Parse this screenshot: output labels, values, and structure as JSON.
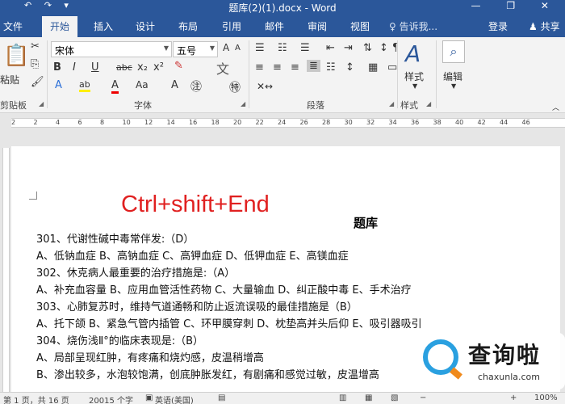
{
  "window": {
    "title": "题库(2)(1).docx - Word",
    "qat": "↶ ↷ ▾",
    "controls": "— ❐ ✕"
  },
  "tabs": [
    {
      "label": "文件"
    },
    {
      "label": "开始"
    },
    {
      "label": "插入"
    },
    {
      "label": "设计"
    },
    {
      "label": "布局"
    },
    {
      "label": "引用"
    },
    {
      "label": "邮件"
    },
    {
      "label": "审阅"
    },
    {
      "label": "视图"
    }
  ],
  "tell_me": "♀ 告诉我...",
  "login": "登录",
  "share": "♟ 共享",
  "ribbon": {
    "paste_label": "粘贴",
    "font_name": "宋体",
    "font_size": "五号",
    "groups": {
      "clipboard": "剪贴板",
      "font": "字体",
      "paragraph": "段落",
      "styles": "样式",
      "styles_btn": "样式",
      "editing": "编辑"
    },
    "font_row1": [
      "B",
      "I",
      "U",
      "abc",
      "x₂",
      "x²"
    ],
    "font_row2": [
      "A",
      "ab",
      "A",
      "Aa",
      "A",
      "㊟"
    ],
    "font_sizes_btns": [
      "A",
      "A",
      "Aa",
      "✎",
      "wen"
    ],
    "para_row1": [
      "☰",
      "☷",
      "☰",
      "⇤",
      "⇥",
      "⇅",
      "↕",
      "¶"
    ],
    "para_row2": [
      "≡",
      "≡",
      "≡",
      "≣",
      "☷",
      "↕",
      "▦",
      "▭"
    ]
  },
  "ruler_numbers": [
    "2",
    "2",
    "4",
    "6",
    "8",
    "10",
    "12",
    "14",
    "16",
    "18",
    "20",
    "22",
    "24",
    "26",
    "28",
    "30",
    "32",
    "34",
    "36",
    "38",
    "40",
    "42",
    "44",
    "46"
  ],
  "overlay_text": "Ctrl+shift+End",
  "doc": {
    "title": "题库",
    "lines": [
      "301、代谢性碱中毒常伴发:（D）",
      "A、低钠血症  B、高钠血症  C、高钾血症  D、低钾血症  E、高镁血症",
      "302、休克病人最重要的治疗措施是:（A）",
      "A、补充血容量    B、应用血管活性药物  C、大量输血  D、纠正酸中毒    E、手术治疗",
      "303、心肺复苏时，维持气道通畅和防止返流误吸的最佳措施是（B）",
      "A、托下颌    B、紧急气管内插管    C、环甲膜穿刺    D、枕垫高并头后仰    E、吸引器吸引",
      "304、烧伤浅Ⅱ°的临床表现是:（B）",
      "A、局部呈现红肿，有疼痛和烧灼感，皮温稍增高",
      "B、渗出较多，水泡较饱满，创底肿胀发红，有剧痛和感觉过敏，皮温增高"
    ]
  },
  "watermark": {
    "cn": "查询啦",
    "en": "chaxunla.com"
  },
  "status": {
    "page": "第 1 页，共 16 页",
    "words": "20015 个字",
    "lang": "英语(美国)",
    "zoom": "100%"
  }
}
